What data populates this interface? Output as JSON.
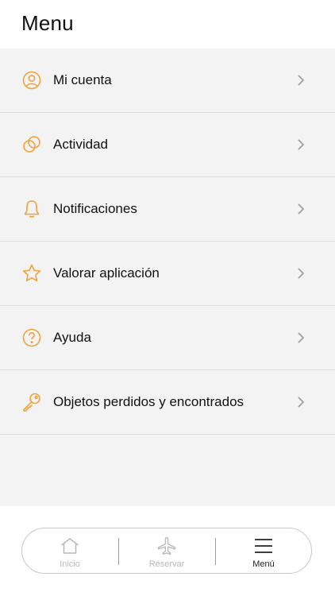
{
  "header": {
    "title": "Menu"
  },
  "menu": {
    "items": [
      {
        "label": "Mi cuenta",
        "icon": "user-circle-icon"
      },
      {
        "label": "Actividad",
        "icon": "overlapping-circles-icon"
      },
      {
        "label": "Notificaciones",
        "icon": "bell-icon"
      },
      {
        "label": "Valorar aplicación",
        "icon": "star-icon"
      },
      {
        "label": "Ayuda",
        "icon": "question-circle-icon"
      },
      {
        "label": "Objetos perdidos y encontrados",
        "icon": "key-icon"
      }
    ],
    "chevron_icon": "chevron-right-icon"
  },
  "tabbar": {
    "tabs": [
      {
        "label": "Inicio",
        "icon": "home-icon",
        "active": false
      },
      {
        "label": "Reservar",
        "icon": "airplane-icon",
        "active": false
      },
      {
        "label": "Menú",
        "icon": "hamburger-icon",
        "active": true
      }
    ]
  },
  "colors": {
    "accent": "#f0a23a",
    "background": "#f3f3f3",
    "text": "#111111",
    "inactive_tab": "#b8b8b8",
    "chevron": "#9a9a9a"
  }
}
